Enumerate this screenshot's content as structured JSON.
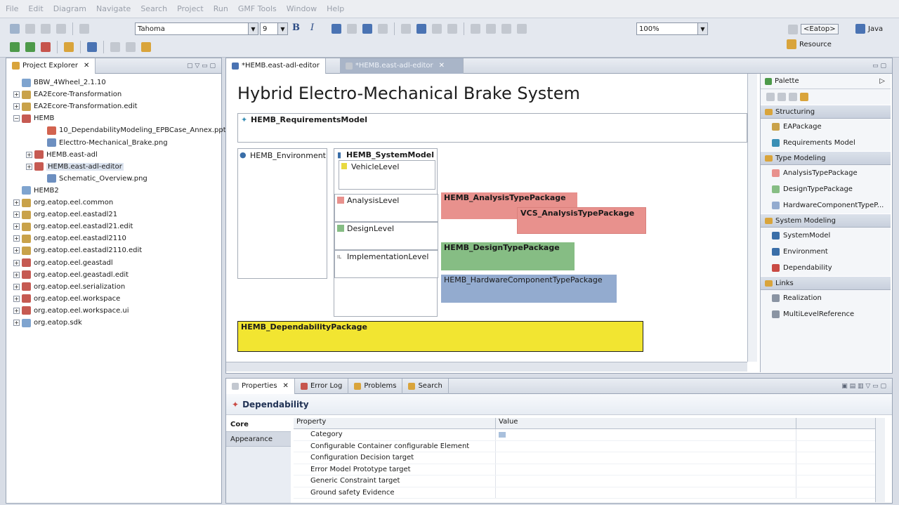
{
  "menu": [
    "File",
    "Edit",
    "Diagram",
    "Navigate",
    "Search",
    "Project",
    "Run",
    "GMF Tools",
    "Window",
    "Help"
  ],
  "toolbar": {
    "font_name": "Tahoma",
    "font_size": "9",
    "bold": "B",
    "italic": "I",
    "zoom": "100%"
  },
  "perspectives": {
    "eatop": "<Eatop>",
    "java": "Java",
    "resource": "Resource"
  },
  "explorer": {
    "title": "Project Explorer",
    "items": [
      {
        "label": "BBW_4Wheel_2.1.10",
        "expander": "",
        "indent": 0,
        "color": "#7fa4cf"
      },
      {
        "label": "EA2Ecore-Transformation",
        "expander": "+",
        "indent": 0,
        "color": "#c9a24a"
      },
      {
        "label": "EA2Ecore-Transformation.edit",
        "expander": "+",
        "indent": 0,
        "color": "#c9a24a"
      },
      {
        "label": "HEMB",
        "expander": "−",
        "indent": 0,
        "color": "#c65a52"
      },
      {
        "label": "10_DependabilityModeling_EPBCase_Annex.ppt",
        "expander": "",
        "indent": 2,
        "color": "#d2634f"
      },
      {
        "label": "Electtro-Mechanical_Brake.png",
        "expander": "",
        "indent": 2,
        "color": "#6d8fc0"
      },
      {
        "label": "HEMB.east-adl",
        "expander": "+",
        "indent": 1,
        "color": "#c65a52"
      },
      {
        "label": "HEMB.east-adl-editor",
        "expander": "+",
        "indent": 1,
        "color": "#c65a52"
      },
      {
        "label": "Schematic_Overview.png",
        "expander": "",
        "indent": 2,
        "color": "#6d8fc0"
      },
      {
        "label": "HEMB2",
        "expander": "",
        "indent": 0,
        "color": "#7fa4cf"
      },
      {
        "label": "org.eatop.eel.common",
        "expander": "+",
        "indent": 0,
        "color": "#c9a24a"
      },
      {
        "label": "org.eatop.eel.eastadl21",
        "expander": "+",
        "indent": 0,
        "color": "#c9a24a"
      },
      {
        "label": "org.eatop.eel.eastadl21.edit",
        "expander": "+",
        "indent": 0,
        "color": "#c9a24a"
      },
      {
        "label": "org.eatop.eel.eastadl2110",
        "expander": "+",
        "indent": 0,
        "color": "#c9a24a"
      },
      {
        "label": "org.eatop.eel.eastadl2110.edit",
        "expander": "+",
        "indent": 0,
        "color": "#c9a24a"
      },
      {
        "label": "org.eatop.eel.geastadl",
        "expander": "+",
        "indent": 0,
        "color": "#c65a52"
      },
      {
        "label": "org.eatop.eel.geastadl.edit",
        "expander": "+",
        "indent": 0,
        "color": "#c65a52"
      },
      {
        "label": "org.eatop.eel.serialization",
        "expander": "+",
        "indent": 0,
        "color": "#c65a52"
      },
      {
        "label": "org.eatop.eel.workspace",
        "expander": "+",
        "indent": 0,
        "color": "#c65a52"
      },
      {
        "label": "org.eatop.eel.workspace.ui",
        "expander": "+",
        "indent": 0,
        "color": "#c65a52"
      },
      {
        "label": "org.eatop.sdk",
        "expander": "+",
        "indent": 0,
        "color": "#7fa4cf"
      }
    ]
  },
  "editor": {
    "tabs": [
      "*HEMB.east-adl-editor",
      "*HEMB.east-adl-editor"
    ],
    "diagram_title": "Hybrid Electro-Mechanical Brake System",
    "requirements_model": "HEMB_RequirementsModel",
    "environment": "HEMB_Environment",
    "system_model": "HEMB_SystemModel",
    "vehicle_level": "VehicleLevel",
    "analysis_level": "AnalysisLevel",
    "design_level": "DesignLevel",
    "implementation_level": "ImplementationLevel",
    "analysis_pkg": "HEMB_AnalysisTypePackage",
    "vcs_pkg": "VCS_AnalysisTypePackage",
    "design_pkg": "HEMB_DesignTypePackage",
    "hardware_pkg": "HEMB_HardwareComponentTypePackage",
    "dependability_pkg": "HEMB_DependabilityPackage",
    "colors": {
      "analysis": "#e8918d",
      "design": "#86bd84",
      "hardware": "#93abcf",
      "dependability": "#f2e531"
    }
  },
  "palette": {
    "title": "Palette",
    "groups": [
      {
        "name": "Structuring",
        "items": [
          "EAPackage",
          "Requirements Model"
        ]
      },
      {
        "name": "Type Modeling",
        "items": [
          "AnalysisTypePackage",
          "DesignTypePackage",
          "HardwareComponentTypeP..."
        ]
      },
      {
        "name": "System Modeling",
        "items": [
          "SystemModel",
          "Environment",
          "Dependability"
        ]
      },
      {
        "name": "Links",
        "items": [
          "Realization",
          "MultiLevelReference"
        ]
      }
    ]
  },
  "bottom": {
    "tabs": [
      "Properties",
      "Error Log",
      "Problems",
      "Search"
    ],
    "selected": "Dependability",
    "side_tabs": [
      "Core",
      "Appearance"
    ],
    "headers": [
      "Property",
      "Value"
    ],
    "rows": [
      "Category",
      "Configurable Container configurable Element",
      "Configuration Decision target",
      "Error Model Prototype target",
      "Generic Constraint target",
      "Ground safety Evidence"
    ]
  }
}
